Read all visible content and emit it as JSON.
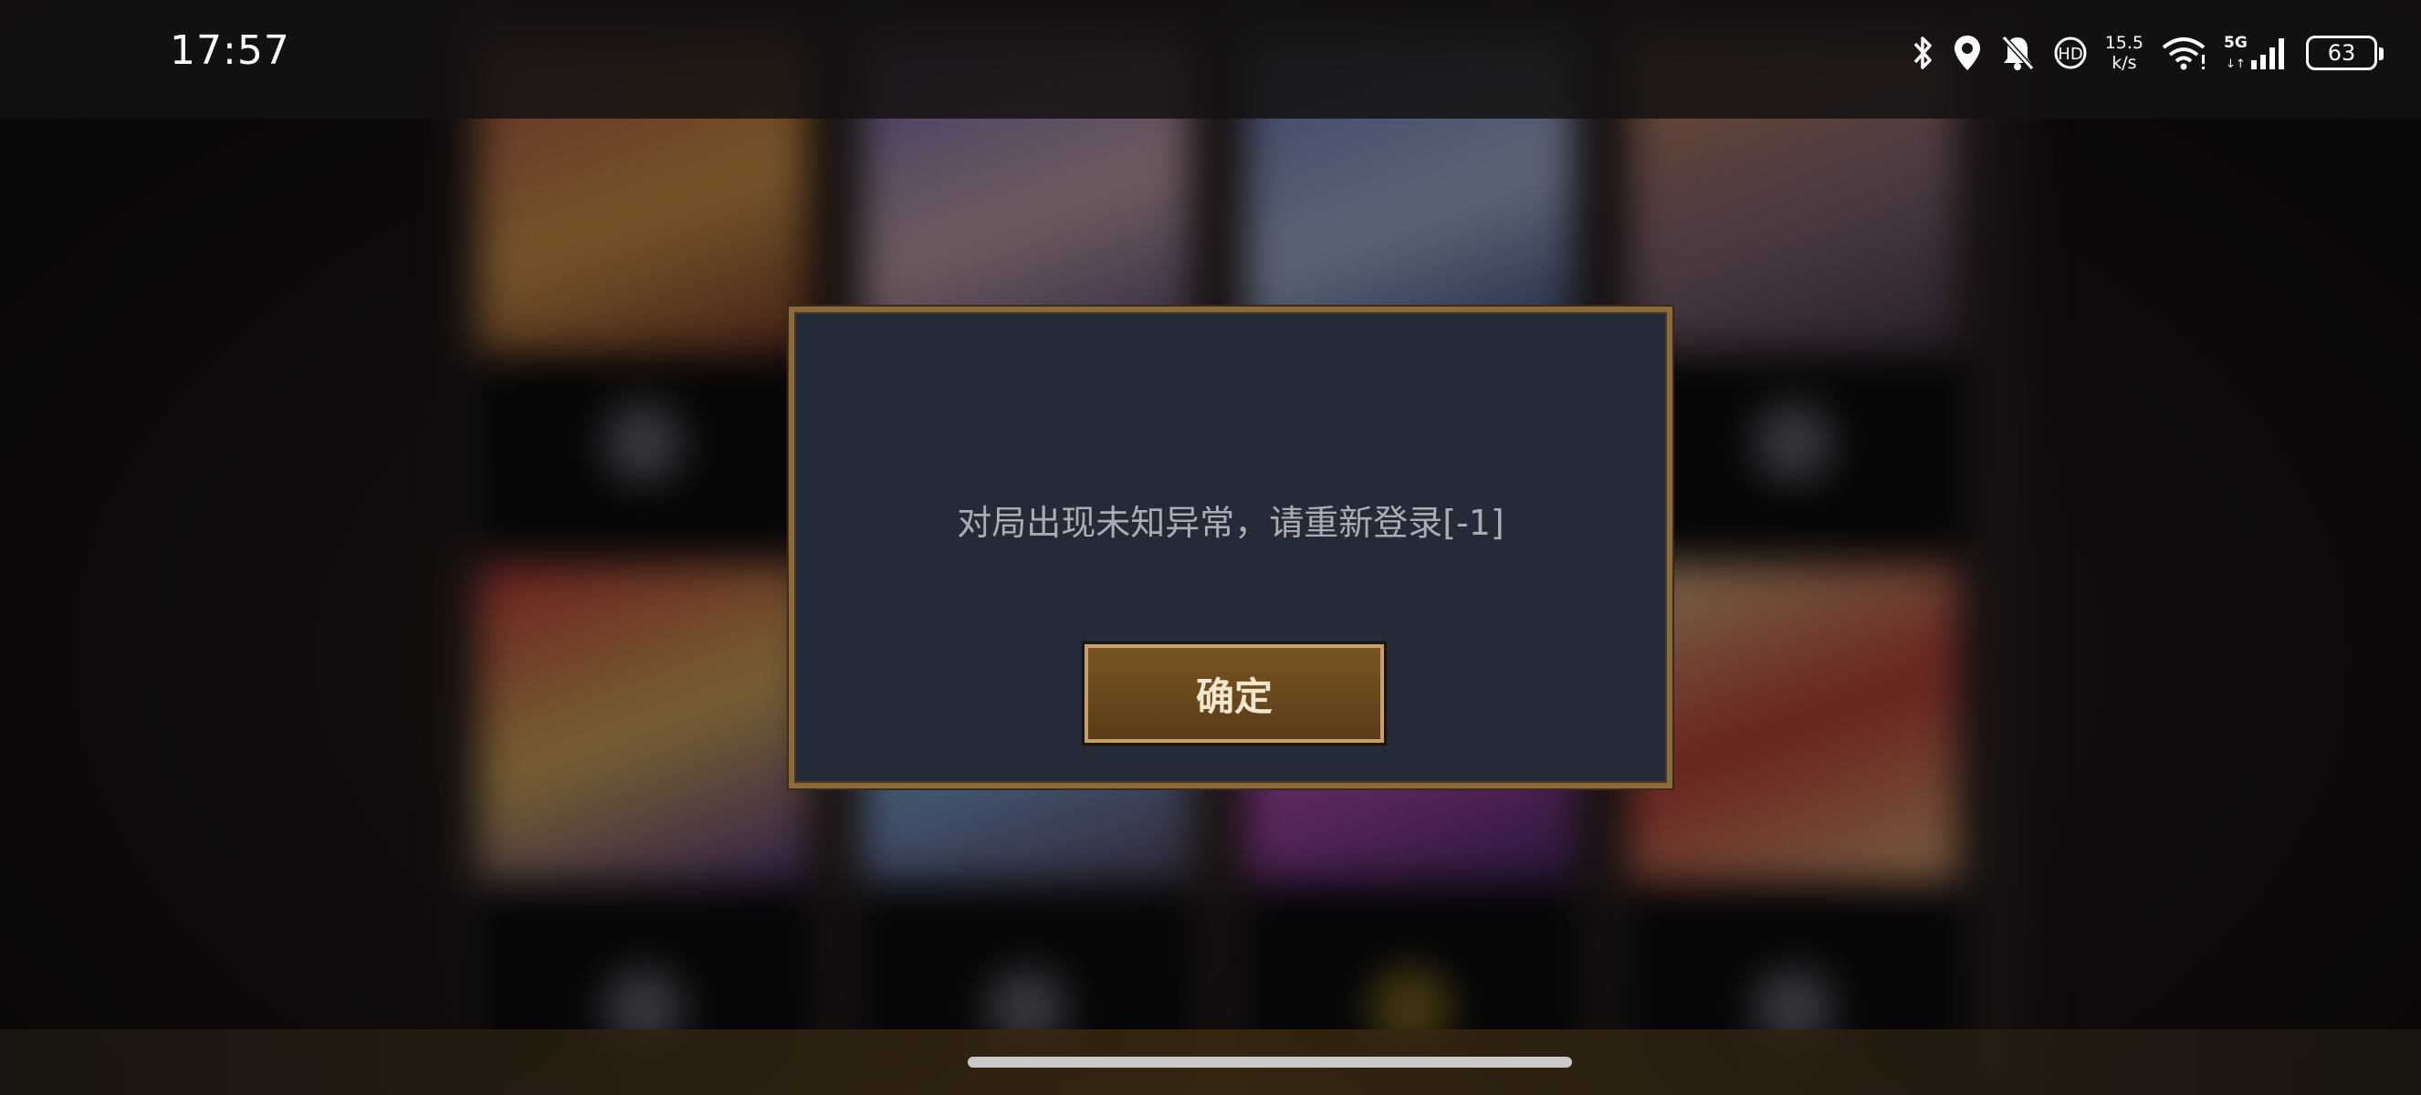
{
  "status_bar": {
    "time": "17:57",
    "net_speed_value": "15.5",
    "net_speed_unit": "k/s",
    "network_type": "5G",
    "battery_level": "63",
    "icons": [
      "bluetooth-icon",
      "location-icon",
      "bell-muted-icon",
      "hd-voice-icon",
      "wifi-icon",
      "cellular-signal-icon",
      "battery-icon"
    ]
  },
  "dialog": {
    "message": "对局出现未知异常，请重新登录[-1]",
    "confirm_label": "确定"
  },
  "colors": {
    "dialog_bg": "#252a38",
    "dialog_border": "#8a6a3a",
    "button_bg": "#6a4820",
    "button_text": "#f3e6cf",
    "message_text": "#a9abb5"
  }
}
